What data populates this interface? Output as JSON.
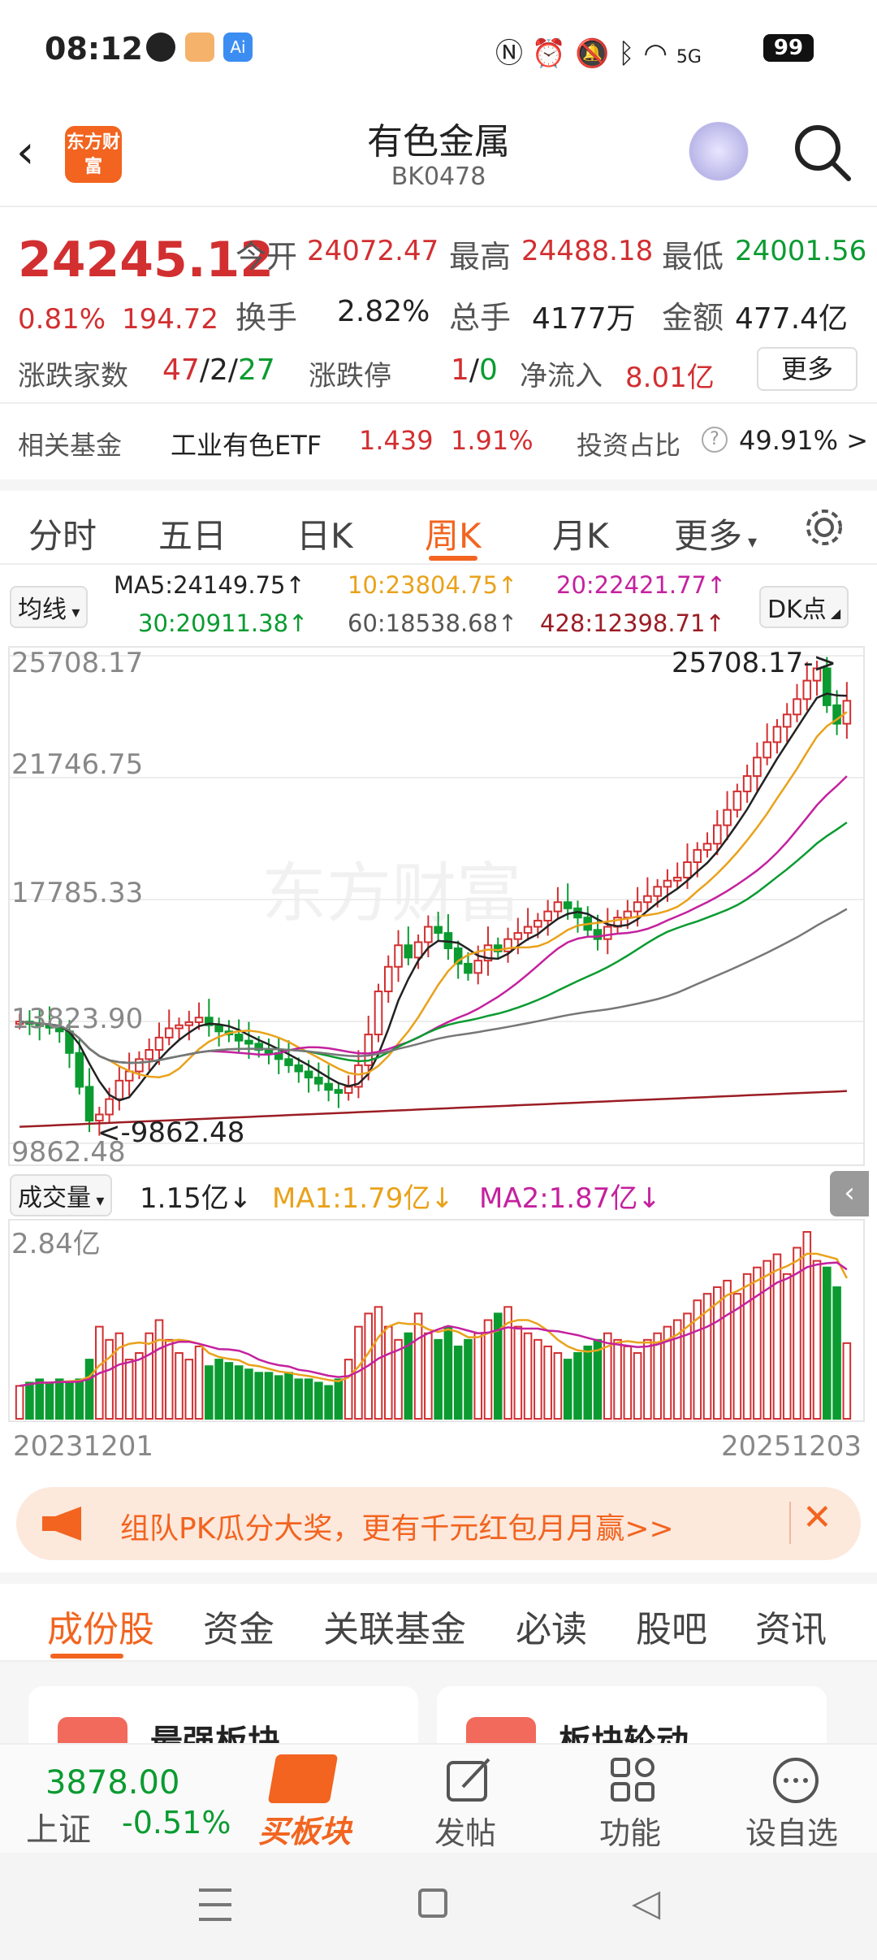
{
  "status": {
    "time": "08:12",
    "battery": "99",
    "network": "5G"
  },
  "header": {
    "title": "有色金属",
    "code": "BK0478",
    "logo_text": "东方财富"
  },
  "quote": {
    "price": "24245.12",
    "pct": "0.81%",
    "chg": "194.72",
    "open_label": "今开",
    "open": "24072.47",
    "high_label": "最高",
    "high": "24488.18",
    "low_label": "最低",
    "low": "24001.56",
    "turnover_label": "换手",
    "turnover": "2.82%",
    "volume_label": "总手",
    "volume": "4177万",
    "amount_label": "金额",
    "amount": "477.4亿",
    "breadth_label": "涨跌家数",
    "up": "47",
    "flat": "2",
    "down": "27",
    "limit_label": "涨跌停",
    "limit_up": "1",
    "limit_down": "0",
    "inflow_label": "净流入",
    "inflow": "8.01亿",
    "more": "更多",
    "fund_label": "相关基金",
    "fund_name": "工业有色ETF",
    "fund_price": "1.439",
    "fund_pct": "1.91%",
    "ratio_label": "投资占比",
    "ratio": "49.91% >"
  },
  "tabs": [
    "分时",
    "五日",
    "日K",
    "周K",
    "月K",
    "更多"
  ],
  "active_tab": 3,
  "ma": {
    "selector": "均线",
    "ma5": "MA5:24149.75↑",
    "ma10": "10:23804.75↑",
    "ma20": "20:22421.77↑",
    "ma30": "30:20911.38↑",
    "ma60": "60:18538.68↑",
    "ma428": "428:12398.71↑",
    "dk": "DK点"
  },
  "chart_data": {
    "type": "candlestick",
    "y_ticks": [
      "25708.17",
      "21746.75",
      "17785.33",
      "13823.90",
      "9862.48"
    ],
    "ylim": [
      9862.48,
      25708.17
    ],
    "high_note": "25708.17->",
    "low_note": "<-9862.48",
    "watermark": "东方财富",
    "x_start": "20231201",
    "x_end": "20251203",
    "closes": [
      13820,
      13750,
      13700,
      13650,
      13500,
      12800,
      11700,
      10600,
      10800,
      11300,
      11900,
      12200,
      12600,
      12900,
      13300,
      13600,
      13700,
      13800,
      13950,
      13700,
      13500,
      13400,
      13200,
      13100,
      12900,
      12800,
      12600,
      12400,
      12200,
      12000,
      11800,
      11600,
      11500,
      11700,
      12400,
      13400,
      14800,
      15600,
      16300,
      15900,
      16400,
      16900,
      16700,
      16200,
      15700,
      15400,
      15800,
      16300,
      16100,
      16500,
      16700,
      16900,
      17100,
      17400,
      17700,
      17500,
      17200,
      16800,
      16500,
      16900,
      17200,
      17400,
      17700,
      17900,
      18200,
      18400,
      18500,
      19000,
      19400,
      19600,
      20200,
      20700,
      21300,
      21800,
      22400,
      22900,
      23400,
      23800,
      24300,
      24900,
      25300,
      24100,
      23500,
      24245
    ]
  },
  "volume": {
    "selector": "成交量",
    "value": "1.15亿↓",
    "ma1": "MA1:1.79亿↓",
    "ma2": "MA2:1.87亿↓",
    "top": "2.84亿"
  },
  "volume_data": [
    0.5,
    0.55,
    0.6,
    0.55,
    0.6,
    0.55,
    0.6,
    0.9,
    1.4,
    1.2,
    1.3,
    0.9,
    1.0,
    1.3,
    1.5,
    1.2,
    1.0,
    0.9,
    1.1,
    0.8,
    0.9,
    0.85,
    0.8,
    0.75,
    0.7,
    0.7,
    0.65,
    0.7,
    0.6,
    0.6,
    0.55,
    0.5,
    0.6,
    0.9,
    1.4,
    1.6,
    1.7,
    1.4,
    1.2,
    1.3,
    1.6,
    1.3,
    1.2,
    1.4,
    1.1,
    1.2,
    1.3,
    1.5,
    1.6,
    1.7,
    1.4,
    1.3,
    1.2,
    1.1,
    1.0,
    0.9,
    1.0,
    1.1,
    1.2,
    1.3,
    1.2,
    1.1,
    1.0,
    1.2,
    1.3,
    1.4,
    1.5,
    1.6,
    1.8,
    1.9,
    2.0,
    2.1,
    1.9,
    2.2,
    2.3,
    2.4,
    2.5,
    2.2,
    2.6,
    2.84,
    2.4,
    2.3,
    2.0,
    1.15
  ],
  "banner": {
    "text": "组队PK瓜分大奖，更有千元红包月月赢>>"
  },
  "subtabs": [
    "成份股",
    "资金",
    "关联基金",
    "必读",
    "股吧",
    "资讯"
  ],
  "cards": [
    "最强板块",
    "板块轮动"
  ],
  "bottom": {
    "index_value": "3878.00",
    "index_name": "上证",
    "index_pct": "-0.51%",
    "buy": "买板块",
    "post": "发帖",
    "func": "功能",
    "watch": "设自选"
  },
  "colors": {
    "up": "#d22f31",
    "down": "#0b9b31",
    "accent": "#f2641f"
  }
}
